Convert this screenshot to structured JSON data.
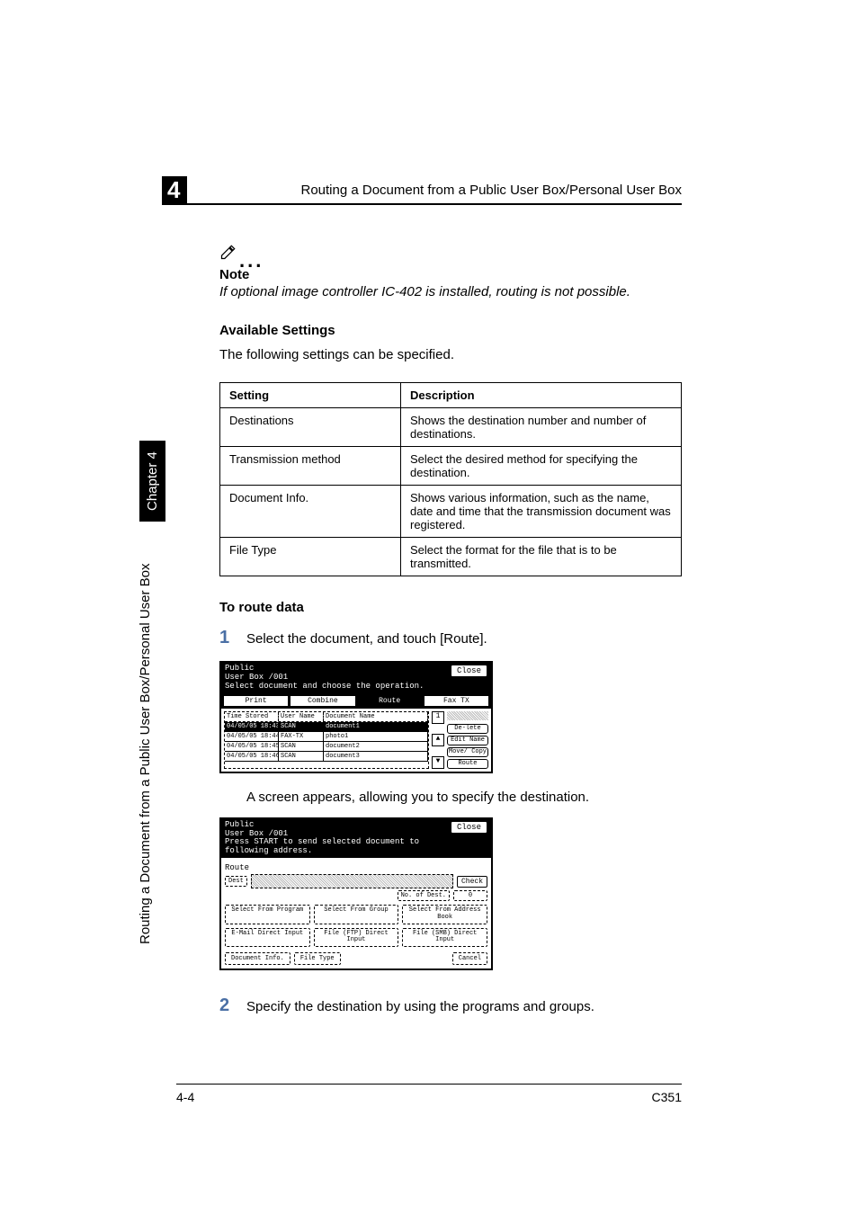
{
  "header": {
    "section_number": "4",
    "running_title": "Routing a Document from a Public User Box/Personal User Box"
  },
  "sidebar": {
    "title": "Routing a Document from a Public User Box/Personal User Box",
    "chapter": "Chapter 4"
  },
  "note": {
    "label": "Note",
    "body": "If optional image controller IC-402 is installed, routing is not possible."
  },
  "available": {
    "heading": "Available Settings",
    "intro": "The following settings can be specified."
  },
  "table": {
    "head_setting": "Setting",
    "head_description": "Description",
    "rows": [
      {
        "s": "Destinations",
        "d": "Shows the destination number and number of destinations."
      },
      {
        "s": "Transmission method",
        "d": "Select the desired method for specifying the destination."
      },
      {
        "s": "Document Info.",
        "d": "Shows various information, such as the name, date and time that the transmission document was registered."
      },
      {
        "s": "File Type",
        "d": "Select the format for the file that is to be transmitted."
      }
    ]
  },
  "procedure": {
    "heading": "To route data",
    "step1_num": "1",
    "step1_text": "Select the document, and touch [Route].",
    "caption1": "A screen appears, allowing you to specify the destination.",
    "step2_num": "2",
    "step2_text": "Specify the destination by using the programs and groups."
  },
  "screen1": {
    "title_l1": "Public",
    "title_l2": "User Box   /001",
    "subtitle": "Select document and choose the operation.",
    "close": "Close",
    "tabs": {
      "print": "Print",
      "combine": "Combine",
      "route": "Route",
      "fax": "Fax TX"
    },
    "head_time": "Time Stored",
    "head_user": "User Name",
    "head_doc": "Document Name",
    "rows": [
      {
        "t": "04/05/05 18:43",
        "u": "SCAN",
        "d": "document1",
        "sel": true
      },
      {
        "t": "04/05/05 18:44",
        "u": "FAX-TX",
        "d": "photo1",
        "sel": false
      },
      {
        "t": "04/05/05 18:45",
        "u": "SCAN",
        "d": "document2",
        "sel": false
      },
      {
        "t": "04/05/05 18:46",
        "u": "SCAN",
        "d": "document3",
        "sel": false
      }
    ],
    "scroll_count": "1",
    "side": {
      "delete": "De-lete",
      "edit": "Edit Name",
      "move": "Move/ Copy",
      "route": "Route"
    }
  },
  "screen2": {
    "title_l1": "Public",
    "title_l2": "User Box   /001",
    "subtitle": "Press START to send selected document to following address.",
    "close": "Close",
    "route_label": "Route",
    "dest_label": "Dest",
    "check": "Check",
    "no_of_dest_label": "No. of Dest.",
    "no_of_dest_value": "0",
    "btns": {
      "program": "Select From Program",
      "group": "Select From Group",
      "address": "Select From Address Book",
      "email": "E-Mail Direct Input",
      "ftp": "File (FTP) Direct Input",
      "smb": "File (SMB) Direct Input",
      "docinfo": "Document Info.",
      "filetype": "File Type",
      "cancel": "Cancel"
    }
  },
  "footer": {
    "page": "4-4",
    "model": "C351"
  }
}
